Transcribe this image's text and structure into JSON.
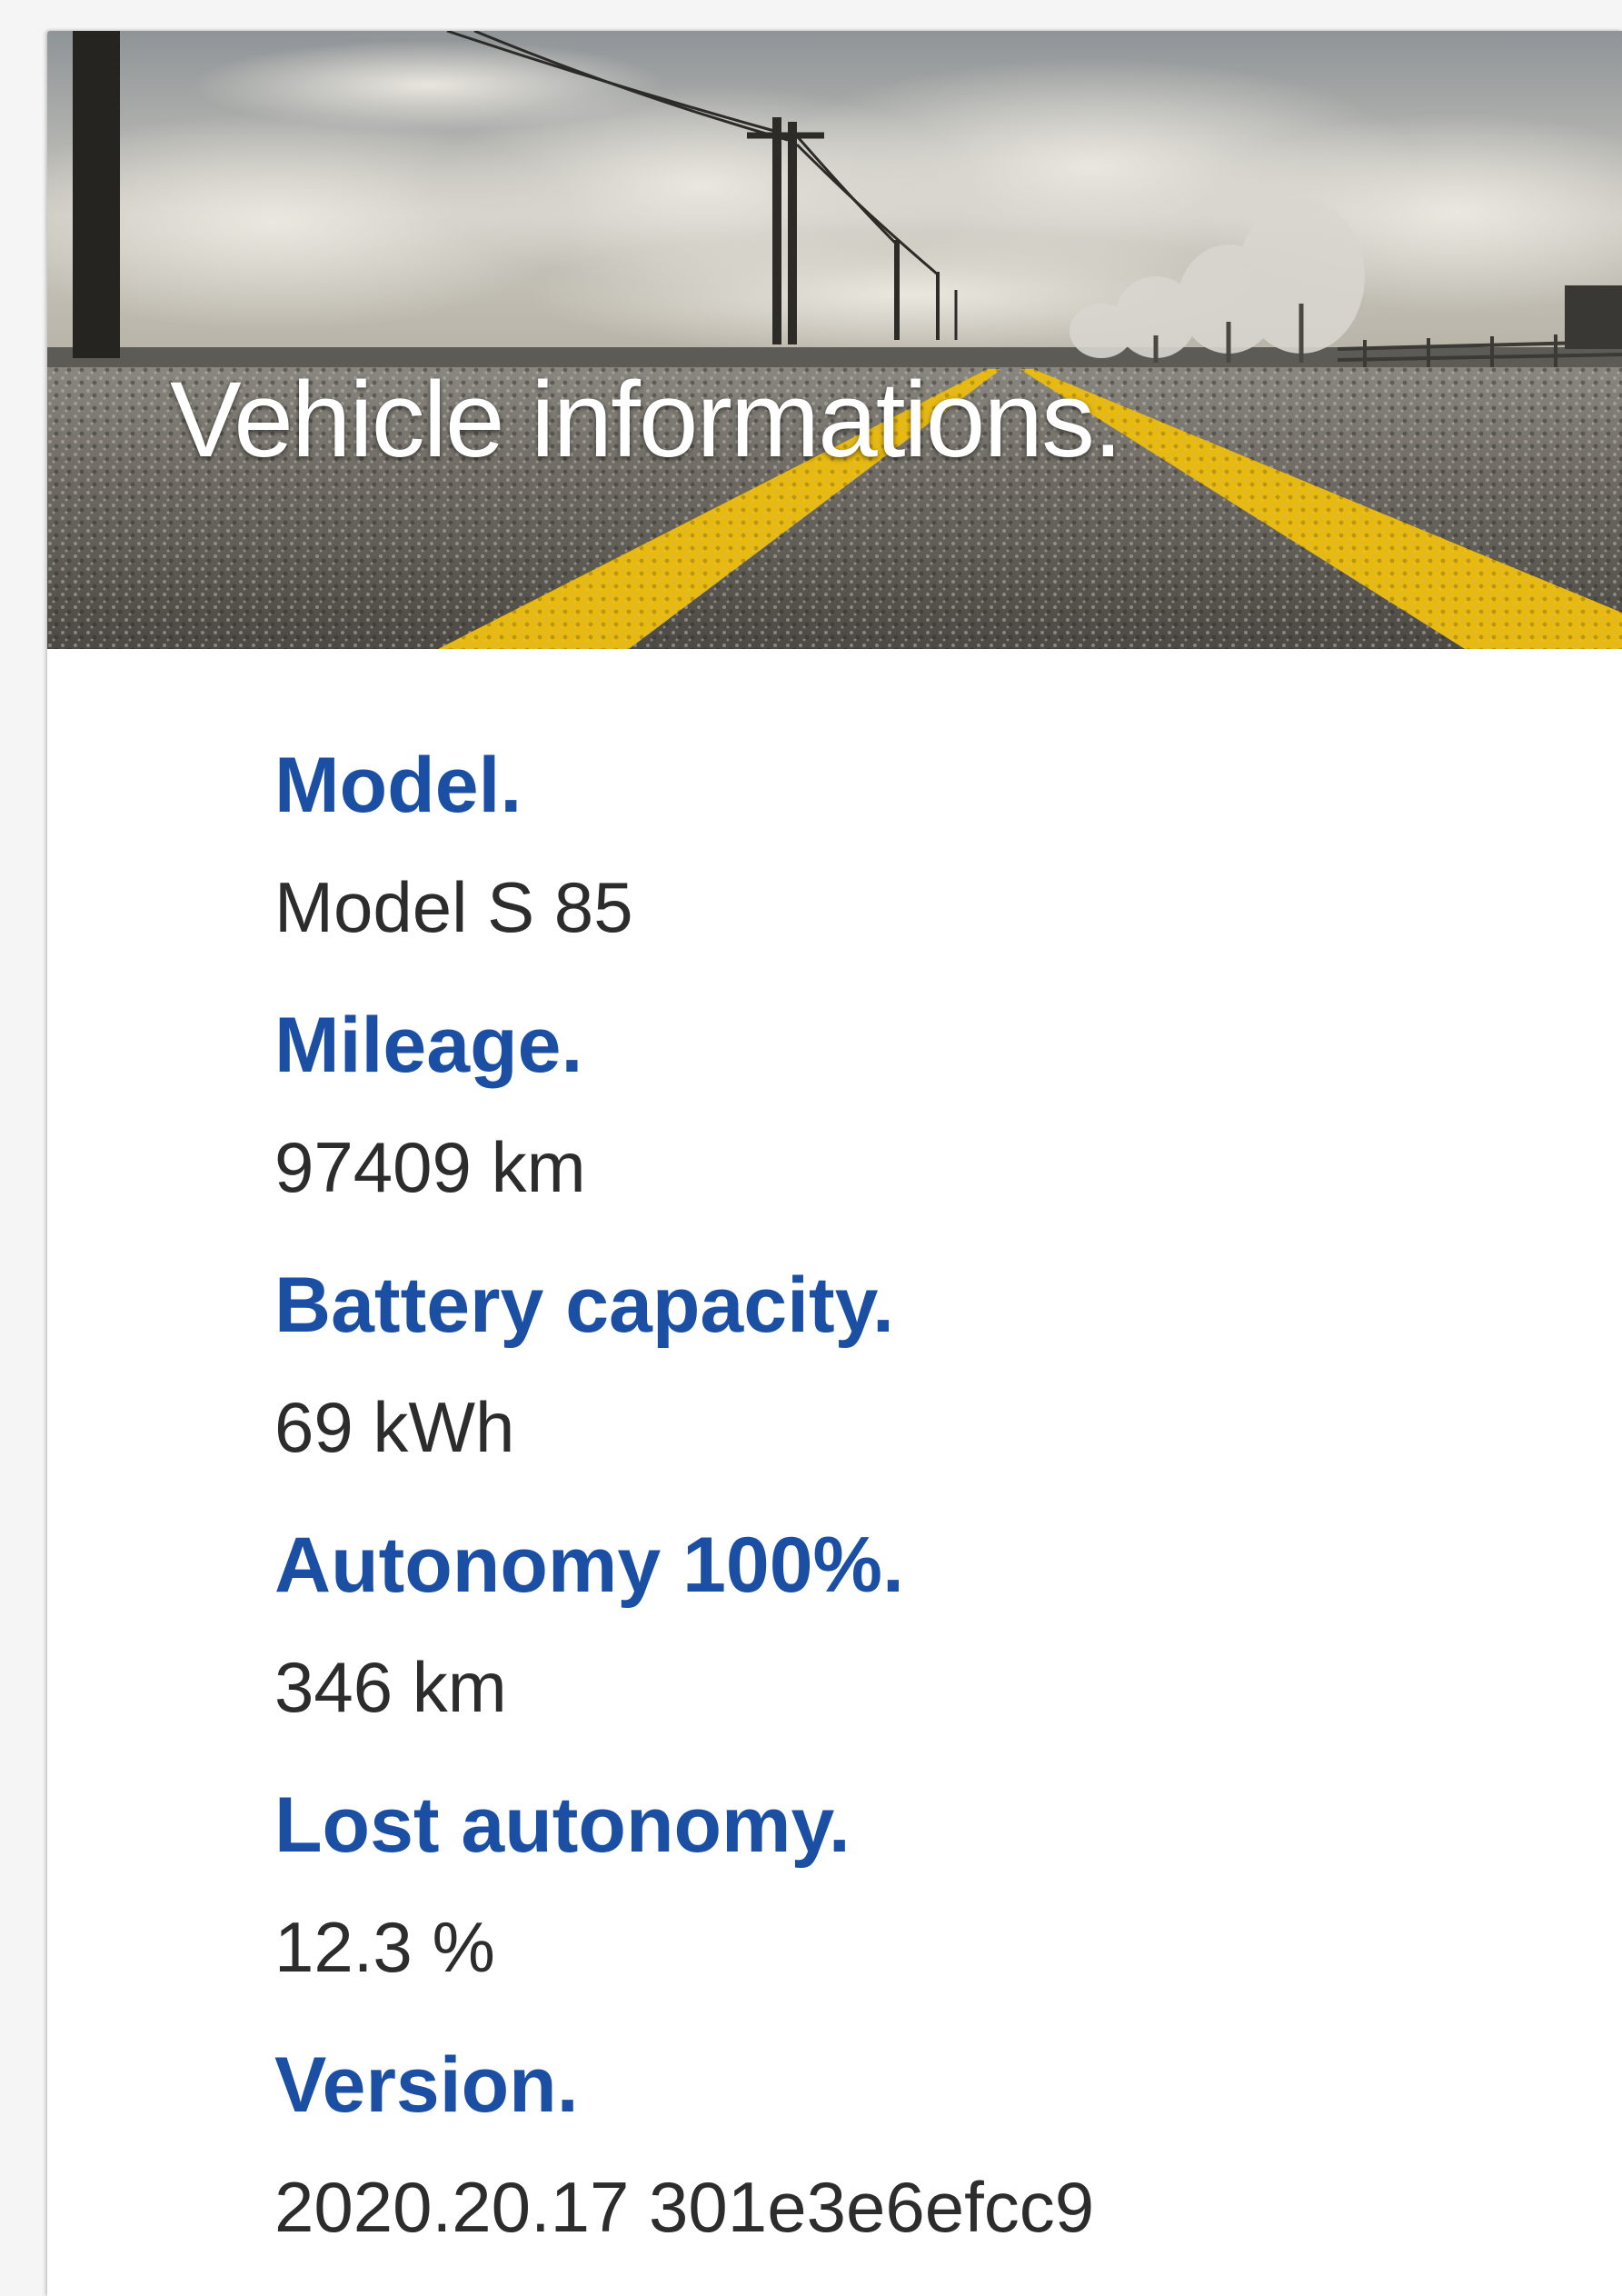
{
  "card": {
    "title": "Vehicle informations.",
    "fields": [
      {
        "label": "Model.",
        "value": "Model S 85"
      },
      {
        "label": "Mileage.",
        "value": "97409 km"
      },
      {
        "label": "Battery capacity.",
        "value": "69 kWh"
      },
      {
        "label": "Autonomy 100%.",
        "value": "346 km"
      },
      {
        "label": "Lost autonomy.",
        "value": "12.3 %"
      },
      {
        "label": "Version.",
        "value": "2020.20.17 301e3e6efcc9"
      }
    ]
  },
  "colors": {
    "label": "#1a4fa3",
    "value": "#2c2c2c",
    "road_line": "#e8b90f",
    "title": "#ffffff"
  }
}
